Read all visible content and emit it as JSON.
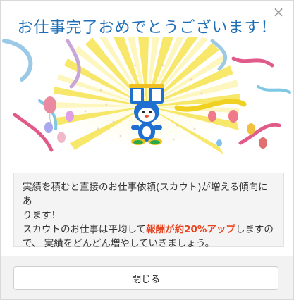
{
  "dialog": {
    "title": "お仕事完了おめでとうございます！",
    "close_icon_glyph": "×",
    "message": {
      "line1": "実績を積むと直接のお仕事依頼(スカウト)が増える傾向にあ",
      "line2": "ります！",
      "line3_prefix": "スカウトのお仕事は平均して",
      "line3_highlight": "報酬が約20%アップ",
      "line3_suffix": "しますの",
      "line4": "で、 実績をどんどん増やしていきましょう。"
    },
    "footer": {
      "close_label": "閉じる"
    }
  },
  "colors": {
    "title": "#1f6fb7",
    "highlight": "#e8431f",
    "mascot_blue": "#1e6fd0",
    "ray_yellow": "#f7e55a"
  },
  "illustration": {
    "mascot": "blue-rabbit-mascot",
    "decorations": [
      "sunburst",
      "balloons",
      "streamers",
      "confetti"
    ]
  }
}
